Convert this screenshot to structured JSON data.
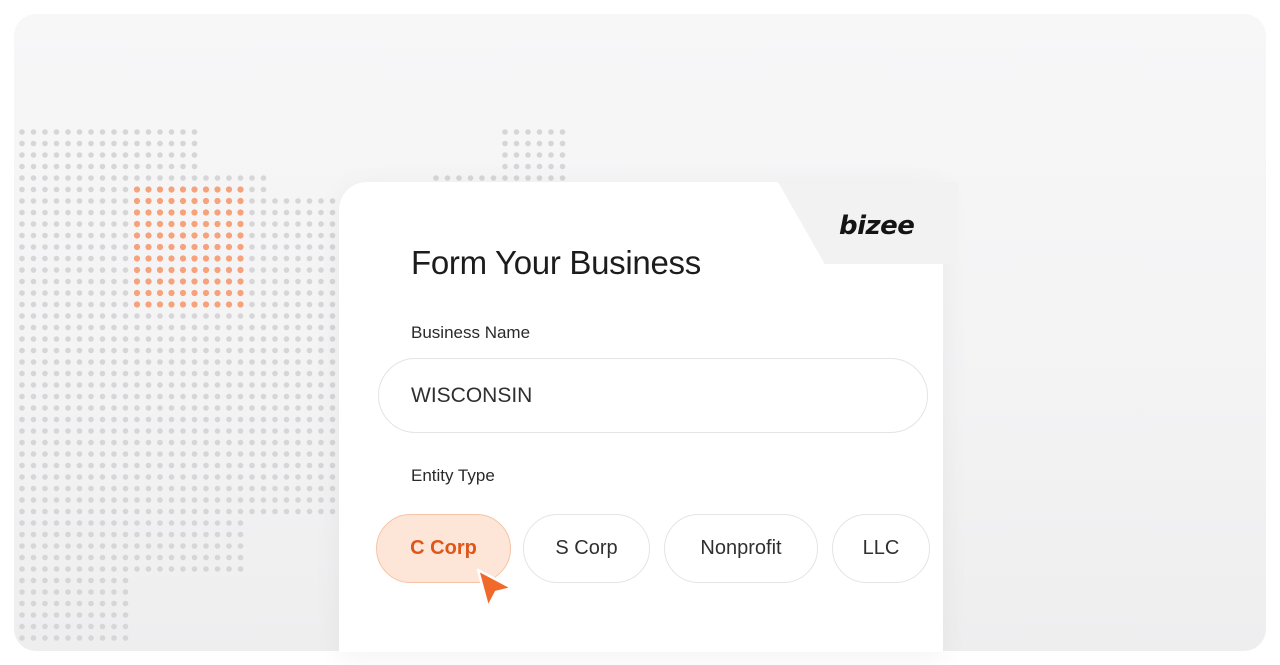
{
  "brand": {
    "logo_text": "bizee",
    "accent_color": "#f26a2b"
  },
  "form": {
    "title": "Form Your Business",
    "business_name": {
      "label": "Business Name",
      "value": "WISCONSIN"
    },
    "entity_type": {
      "label": "Entity Type",
      "options": [
        "C Corp",
        "S Corp",
        "Nonprofit",
        "LLC"
      ],
      "selected": "C Corp"
    }
  },
  "background": {
    "map_highlight": "Wisconsin",
    "icons": [
      "dotted-us-map",
      "pointer-cursor-icon"
    ]
  }
}
